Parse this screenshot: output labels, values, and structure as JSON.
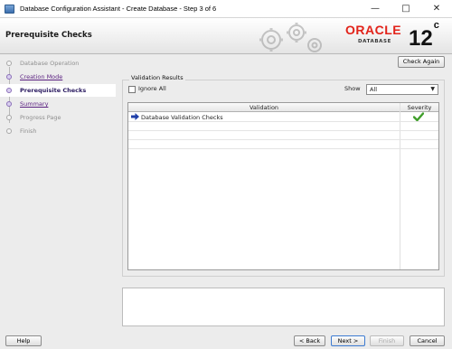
{
  "window": {
    "title": "Database Configuration Assistant - Create Database - Step 3 of 6"
  },
  "header": {
    "title": "Prerequisite Checks",
    "logo_text": "ORACLE",
    "logo_sub": "DATABASE",
    "version": "12",
    "version_sup": "c",
    "brand_color": "#e2231a"
  },
  "steps": [
    {
      "label": "Database Operation",
      "state": "done"
    },
    {
      "label": "Creation Mode",
      "state": "link"
    },
    {
      "label": "Prerequisite Checks",
      "state": "active"
    },
    {
      "label": "Summary",
      "state": "link"
    },
    {
      "label": "Progress Page",
      "state": "pending"
    },
    {
      "label": "Finish",
      "state": "pending"
    }
  ],
  "toolbar": {
    "check_again": "Check Again"
  },
  "validation": {
    "group_label": "Validation Results",
    "ignore_all": "Ignore All",
    "show_label": "Show",
    "show_value": "All",
    "columns": [
      "Validation",
      "Severity"
    ],
    "rows": [
      {
        "validation": "Database Validation Checks",
        "severity_icon": "check-icon"
      }
    ]
  },
  "footer": {
    "help": "Help",
    "back": "< Back",
    "next": "Next >",
    "finish": "Finish",
    "cancel": "Cancel"
  }
}
